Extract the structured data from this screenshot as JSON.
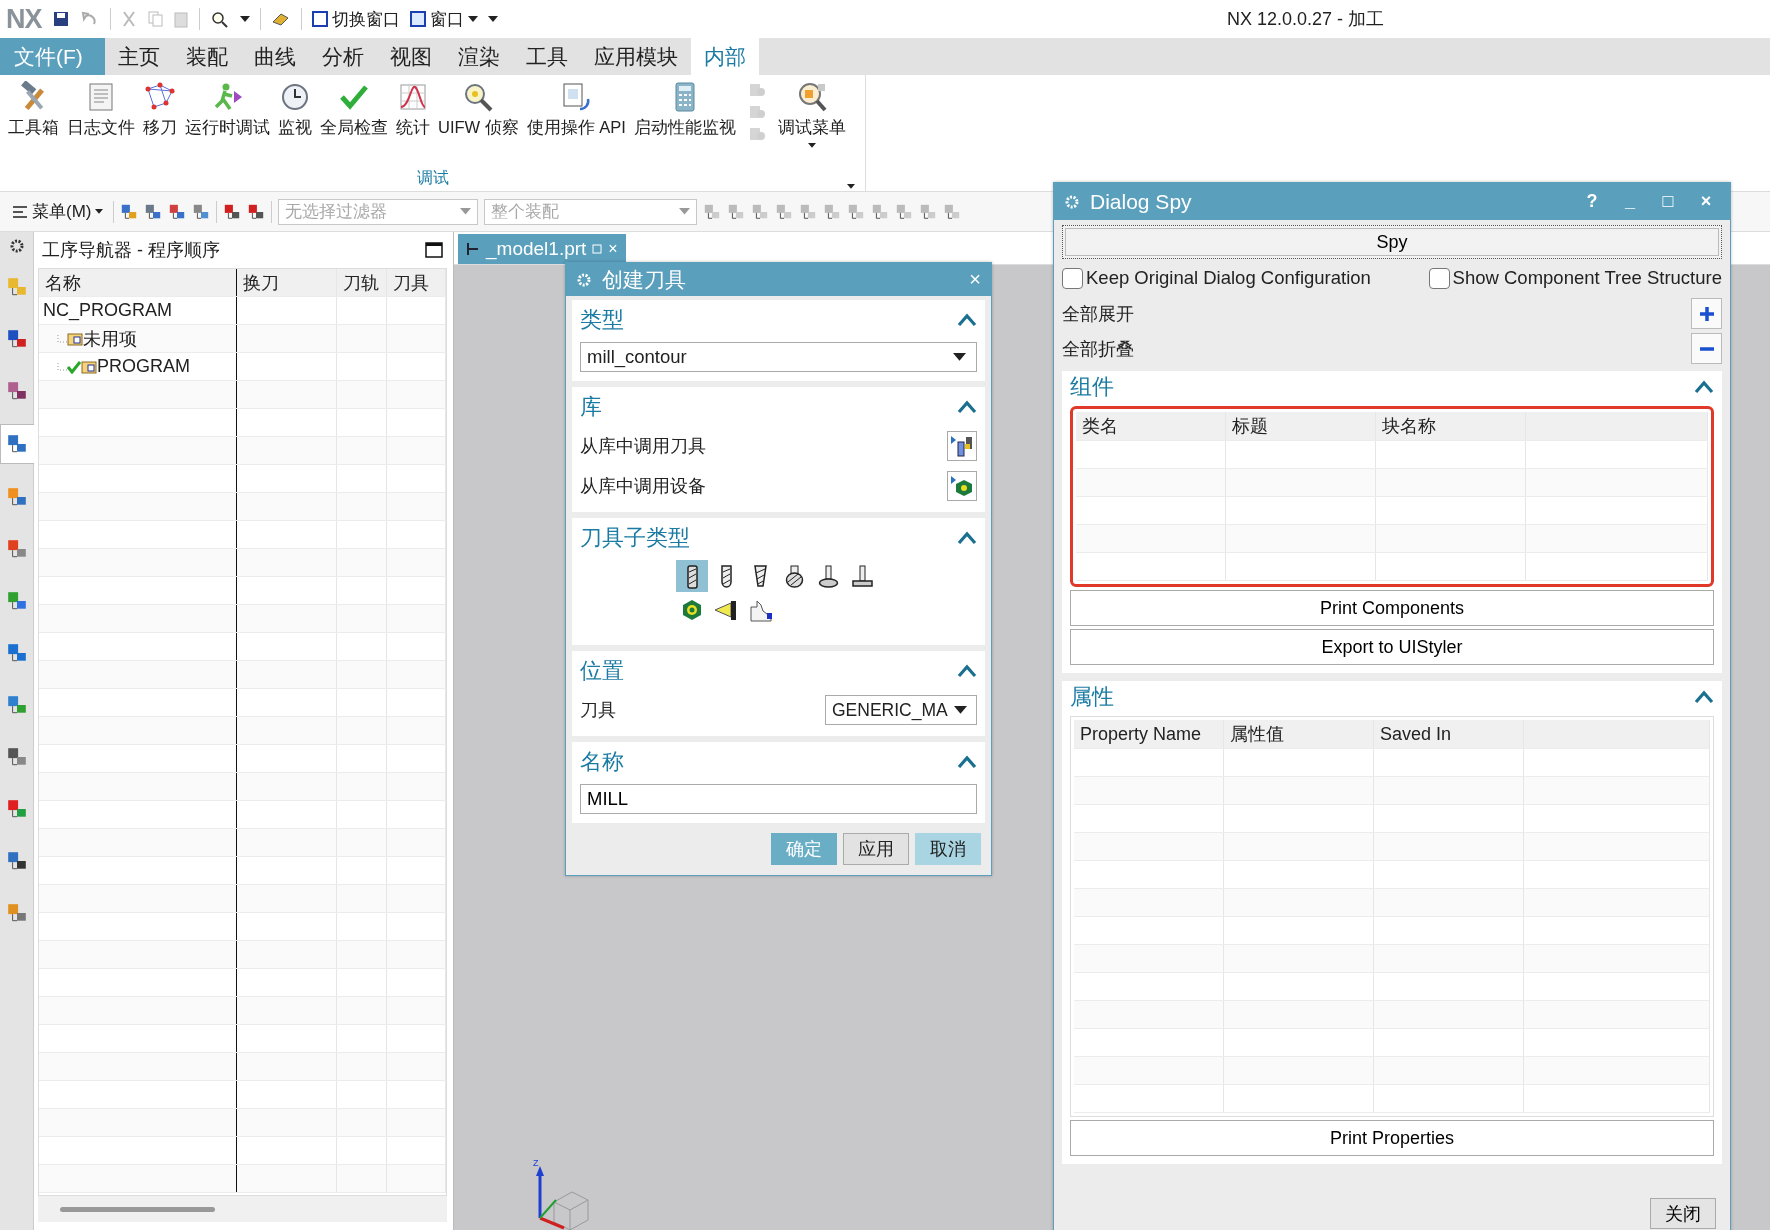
{
  "title_bar": {
    "logo": "NX",
    "quick_access": [
      {
        "label": "切换窗口"
      },
      {
        "label": "窗口"
      }
    ],
    "title": "NX 12.0.0.27 - 加工"
  },
  "ribbon": {
    "tabs": [
      {
        "label": "文件(F)",
        "kind": "file",
        "selected": false
      },
      {
        "label": "主页",
        "kind": "tab",
        "selected": false
      },
      {
        "label": "装配",
        "kind": "tab",
        "selected": false
      },
      {
        "label": "曲线",
        "kind": "tab",
        "selected": false
      },
      {
        "label": "分析",
        "kind": "tab",
        "selected": false
      },
      {
        "label": "视图",
        "kind": "tab",
        "selected": false
      },
      {
        "label": "渲染",
        "kind": "tab",
        "selected": false
      },
      {
        "label": "工具",
        "kind": "tab",
        "selected": false
      },
      {
        "label": "应用模块",
        "kind": "tab",
        "selected": false
      },
      {
        "label": "内部",
        "kind": "tab",
        "selected": true
      }
    ],
    "commands": [
      {
        "label": "工具箱"
      },
      {
        "label": "日志文件"
      },
      {
        "label": "移刀"
      },
      {
        "label": "运行时调试"
      },
      {
        "label": "监视"
      },
      {
        "label": "全局检查"
      },
      {
        "label": "统计"
      },
      {
        "label": "UIFW 侦察"
      },
      {
        "label": "使用操作 API"
      },
      {
        "label": "启动性能监视"
      },
      {
        "label": "调试菜单"
      }
    ],
    "group_label": "调试"
  },
  "toolbar": {
    "menu": "菜单(M)",
    "filters": [
      {
        "value": "无选择过滤器",
        "disabled": true
      },
      {
        "value": "整个装配",
        "disabled": true
      }
    ]
  },
  "navigator": {
    "title": "工序导航器 - 程序顺序",
    "columns": [
      "名称",
      "换刀",
      "刀轨",
      "刀具"
    ],
    "tree": [
      {
        "label": "NC_PROGRAM",
        "children": [
          {
            "label": "未用项"
          },
          {
            "label": "PROGRAM",
            "complete": true
          }
        ]
      }
    ]
  },
  "graphics": {
    "tabs": [
      {
        "label": "_model1.prt",
        "close": "×",
        "selected": true
      }
    ],
    "triad_label": "Z"
  },
  "create_tool": {
    "title": "创建刀具",
    "close": "×",
    "sections": [
      {
        "kind": "dropdown",
        "title": "类型",
        "expanded": true,
        "value": "mill_contour"
      },
      {
        "kind": "library",
        "title": "库",
        "expanded": true,
        "rows": [
          {
            "label": "从库中调用刀具"
          },
          {
            "label": "从库中调用设备"
          }
        ]
      },
      {
        "kind": "subtypes",
        "title": "刀具子类型",
        "expanded": true,
        "items": [
          {
            "selected": true
          },
          {
            "selected": false
          },
          {
            "selected": false
          },
          {
            "selected": false
          },
          {
            "selected": false
          },
          {
            "selected": false
          },
          {
            "selected": false
          },
          {
            "selected": false
          },
          {
            "selected": false
          }
        ]
      },
      {
        "kind": "labeled_dropdown",
        "title": "位置",
        "expanded": true,
        "label": "刀具",
        "value": "GENERIC_MA"
      },
      {
        "kind": "text_input",
        "title": "名称",
        "expanded": true,
        "value": "MILL"
      }
    ],
    "buttons": [
      {
        "label": "确定",
        "kind": "primary"
      },
      {
        "label": "应用",
        "kind": "normal"
      },
      {
        "label": "取消",
        "kind": "light"
      }
    ]
  },
  "dialog_spy": {
    "title": "Dialog Spy",
    "title_controls": [
      "?",
      "_",
      "□",
      "×"
    ],
    "spy_button": "Spy",
    "options": [
      {
        "label": "Keep Original Dialog Configuration",
        "checked": false
      },
      {
        "label": "Show Component Tree Structure",
        "checked": false
      }
    ],
    "tree_actions": [
      {
        "label": "全部展开",
        "kind": "expand"
      },
      {
        "label": "全部折叠",
        "kind": "collapse"
      }
    ],
    "components": {
      "title": "组件",
      "expanded": true,
      "highlighted": true,
      "columns": [
        "类名",
        "标题",
        "块名称"
      ],
      "buttons": [
        "Print Components",
        "Export to UIStyler"
      ]
    },
    "properties": {
      "title": "属性",
      "expanded": true,
      "highlighted": false,
      "columns": [
        "Property Name",
        "属性值",
        "Saved In"
      ],
      "buttons": [
        "Print Properties"
      ]
    },
    "close_button": "关闭"
  }
}
